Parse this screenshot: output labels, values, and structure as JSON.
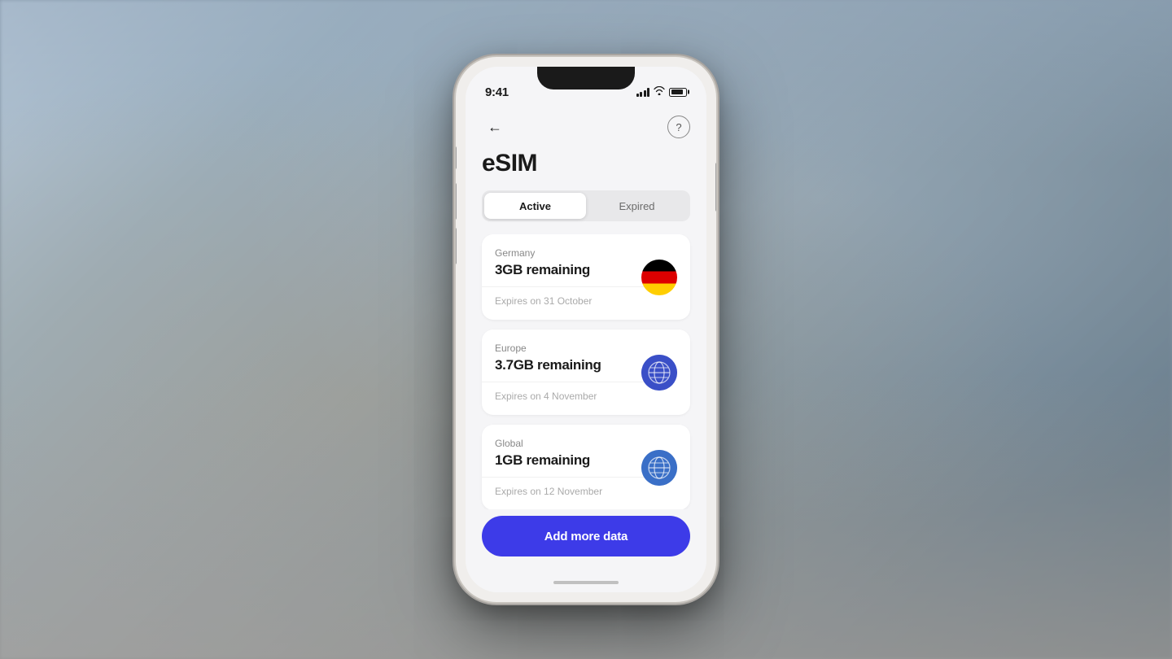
{
  "background": {
    "description": "Blurred airport terminal background"
  },
  "phone": {
    "status_bar": {
      "time": "9:41",
      "signal_label": "signal",
      "wifi_label": "wifi",
      "battery_label": "battery"
    },
    "screen": {
      "title": "eSIM",
      "help_button_label": "?",
      "back_button_label": "←",
      "tabs": [
        {
          "label": "Active",
          "active": true
        },
        {
          "label": "Expired",
          "active": false
        }
      ],
      "esim_list": [
        {
          "region": "Germany",
          "data_remaining": "3GB remaining",
          "expiry": "Expires on 31 October",
          "flag_type": "germany"
        },
        {
          "region": "Europe",
          "data_remaining": "3.7GB remaining",
          "expiry": "Expires on 4 November",
          "flag_type": "globe-europe"
        },
        {
          "region": "Global",
          "data_remaining": "1GB remaining",
          "expiry": "Expires on 12 November",
          "flag_type": "globe-global"
        }
      ],
      "add_data_button": "Add more data"
    }
  }
}
